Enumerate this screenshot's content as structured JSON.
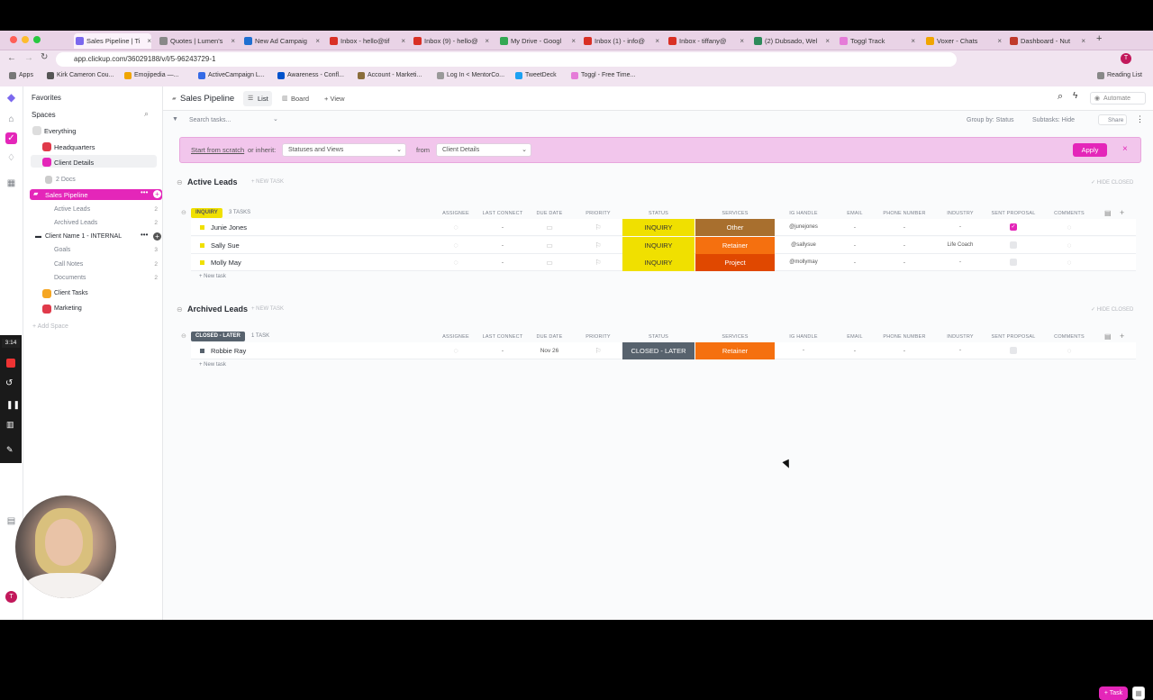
{
  "browser": {
    "tabs": [
      {
        "label": "Sales Pipeline | Ti",
        "active": true,
        "fav_color": "#7b68ee"
      },
      {
        "label": "Quotes | Lumen's",
        "fav_color": "#888"
      },
      {
        "label": "New Ad Campaig",
        "fav_color": "#1f6fd1"
      },
      {
        "label": "Inbox - hello@tif",
        "fav_color": "#d93025"
      },
      {
        "label": "Inbox (9) - hello@",
        "fav_color": "#d93025"
      },
      {
        "label": "My Drive - Googl",
        "fav_color": "#34a853"
      },
      {
        "label": "Inbox (1) - info@",
        "fav_color": "#d93025"
      },
      {
        "label": "Inbox - tiffany@",
        "fav_color": "#d93025"
      },
      {
        "label": "(2) Dubsado, Wel",
        "fav_color": "#2d8a5a"
      },
      {
        "label": "Toggl Track",
        "fav_color": "#e57cd8"
      },
      {
        "label": "Voxer - Chats",
        "fav_color": "#f0a500"
      },
      {
        "label": "Dashboard - Nut",
        "fav_color": "#c0392b"
      }
    ],
    "url": "app.clickup.com/36029188/v/l/5-96243729-1",
    "bookmarks": [
      {
        "label": "Apps",
        "color": "#777"
      },
      {
        "label": "Kirk Cameron Cou...",
        "color": "#555"
      },
      {
        "label": "Emojipedia —...",
        "color": "#f0a500"
      },
      {
        "label": "ActiveCampaign L...",
        "color": "#356ae6"
      },
      {
        "label": "Awareness - Confl...",
        "color": "#0052cc"
      },
      {
        "label": "Account - Marketi...",
        "color": "#8a6d3b"
      },
      {
        "label": "Log In < MentorCo...",
        "color": "#999"
      },
      {
        "label": "TweetDeck",
        "color": "#1da1f2"
      },
      {
        "label": "Toggl - Free Time...",
        "color": "#e57cd8"
      }
    ],
    "reading_list": "Reading List"
  },
  "sidebar": {
    "favorites": "Favorites",
    "spaces": "Spaces",
    "everything": "Everything",
    "headquarters": "Headquarters",
    "client_details": "Client Details",
    "docs": "2 Docs",
    "sales_pipeline": "Sales Pipeline",
    "active_leads": "Active Leads",
    "active_leads_count": "2",
    "archived_leads": "Archived Leads",
    "archived_leads_count": "2",
    "client_name": "Client Name 1 - INTERNAL",
    "goals": "Goals",
    "goals_count": "3",
    "call_notes": "Call Notes",
    "call_notes_count": "2",
    "documents": "Documents",
    "documents_count": "2",
    "client_tasks": "Client Tasks",
    "marketing": "Marketing",
    "add_space": "+ Add Space",
    "timer": "3:14"
  },
  "header": {
    "title": "Sales Pipeline",
    "list": "List",
    "board": "Board",
    "view": "+ View",
    "automate": "Automate",
    "search_placeholder": "Search tasks...",
    "group_by": "Group by: Status",
    "subtasks": "Subtasks: Hide",
    "share": "Share"
  },
  "banner": {
    "start": "Start from scratch",
    "or_inherit": "or inherit:",
    "statuses": "Statuses and Views",
    "from": "from",
    "client_details": "Client Details",
    "apply": "Apply"
  },
  "columns": [
    "ASSIGNEE",
    "LAST CONNECT",
    "DUE DATE",
    "PRIORITY",
    "STATUS",
    "SERVICES",
    "IG HANDLE",
    "EMAIL",
    "PHONE NUMBER",
    "INDUSTRY",
    "SENT PROPOSAL",
    "COMMENTS"
  ],
  "groups": [
    {
      "title": "Active Leads",
      "new_task": "+ NEW TASK",
      "hide_closed": "✓ HIDE CLOSED",
      "status_label": "INQUIRY",
      "status_color": "#f0e000",
      "count": "3 TASKS",
      "add": "+ New task",
      "tasks": [
        {
          "name": "Junie Jones",
          "last": "-",
          "due": "",
          "status": "INQUIRY",
          "service": "Other",
          "service_color": "#a86f2e",
          "ig": "@junejones",
          "email": "-",
          "phone": "-",
          "industry": "-",
          "sent": true
        },
        {
          "name": "Sally Sue",
          "last": "-",
          "due": "",
          "status": "INQUIRY",
          "service": "Retainer",
          "service_color": "#f5700f",
          "ig": "@sallysue",
          "email": "-",
          "phone": "-",
          "industry": "Life Coach",
          "sent": false
        },
        {
          "name": "Molly May",
          "last": "-",
          "due": "",
          "status": "INQUIRY",
          "service": "Project",
          "service_color": "#e04800",
          "ig": "@mollymay",
          "email": "-",
          "phone": "-",
          "industry": "-",
          "sent": false
        }
      ]
    },
    {
      "title": "Archived Leads",
      "new_task": "+ NEW TASK",
      "hide_closed": "✓ HIDE CLOSED",
      "status_label": "CLOSED - LATER",
      "status_color": "#57626d",
      "count": "1 TASK",
      "add": "+ New task",
      "tasks": [
        {
          "name": "Robbie Ray",
          "last": "-",
          "due": "Nov 26",
          "status": "CLOSED - LATER",
          "service": "Retainer",
          "service_color": "#f5700f",
          "ig": "-",
          "email": "-",
          "phone": "-",
          "industry": "-",
          "sent": false
        }
      ]
    }
  ],
  "fab": "+ Task"
}
